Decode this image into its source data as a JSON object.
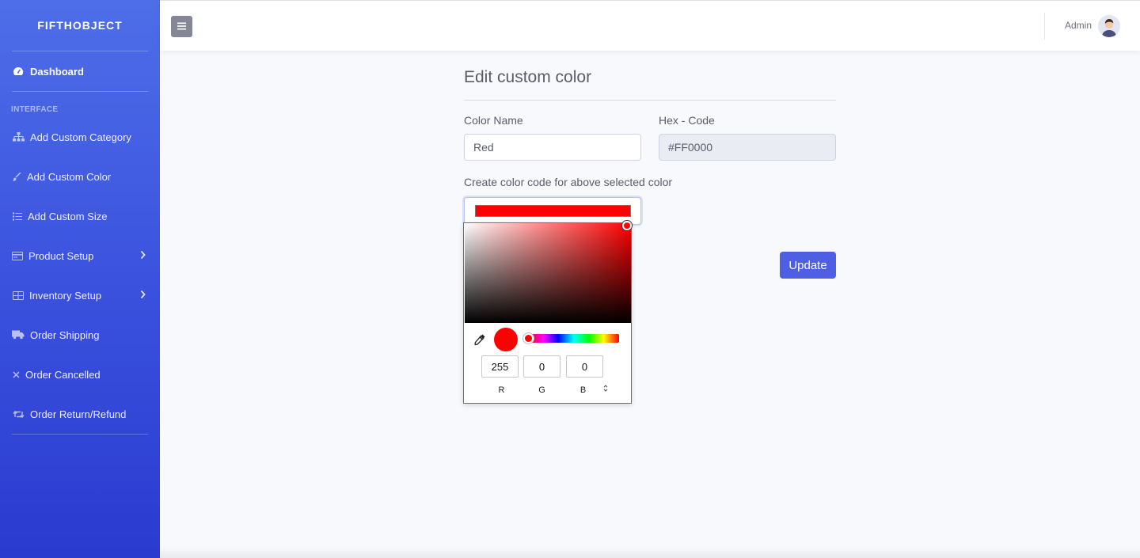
{
  "sidebar": {
    "brand": "FIFTHOBJECT",
    "dashboard": "Dashboard",
    "section_heading": "INTERFACE",
    "items": [
      {
        "label": "Add Custom Category",
        "icon": "sitemap-icon"
      },
      {
        "label": "Add Custom Color",
        "icon": "brush-icon"
      },
      {
        "label": "Add Custom Size",
        "icon": "list-icon"
      },
      {
        "label": "Product Setup",
        "icon": "card-icon"
      },
      {
        "label": "Inventory Setup",
        "icon": "table-icon"
      },
      {
        "label": "Order Shipping",
        "icon": "truck-icon"
      },
      {
        "label": "Order Cancelled",
        "icon": "x-icon"
      },
      {
        "label": "Order Return/Refund",
        "icon": "retweet-icon"
      }
    ]
  },
  "topbar": {
    "user_name": "Admin"
  },
  "form": {
    "title": "Edit custom color",
    "color_name_label": "Color Name",
    "color_name_value": "Red",
    "hex_label": "Hex - Code",
    "hex_value": "#FF0000",
    "picker_label": "Create color code for above selected color",
    "selected_color": "#ff0000",
    "update_label": "Update"
  },
  "picker": {
    "r": "255",
    "g": "0",
    "b": "0",
    "r_label": "R",
    "g_label": "G",
    "b_label": "B"
  }
}
